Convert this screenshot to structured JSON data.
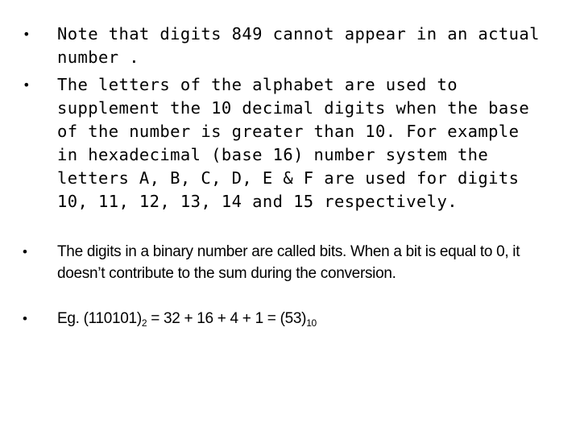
{
  "slide": {
    "bullets": [
      {
        "marker": "•",
        "text": "Note that digits 849 cannot appear in an actual number ."
      },
      {
        "marker": "•",
        "text": "The letters of the alphabet are used to supplement the 10 decimal digits when the base of the number is greater than 10. For example in hexadecimal (base 16) number system the letters A, B, C, D, E & F are used for digits 10, 11, 12, 13, 14 and 15 respectively."
      },
      {
        "marker": "•",
        "text": "The digits in a binary number are called bits. When a bit is equal to 0, it doesn’t contribute to the sum during the conversion."
      },
      {
        "marker": "•",
        "prefix": "Eg. (110101)",
        "sub1": "2",
        "middle": " = 32 + 16 + 4 + 1 = (53)",
        "sub2": "10"
      }
    ]
  }
}
